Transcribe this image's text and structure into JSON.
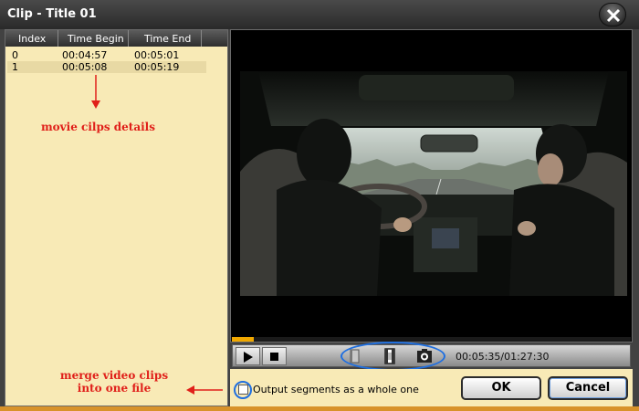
{
  "window": {
    "title": "Clip - Title 01"
  },
  "clips_table": {
    "headers": [
      "Index",
      "Time Begin",
      "Time End"
    ],
    "rows": [
      {
        "index": "0",
        "begin": "00:04:57",
        "end": "00:05:01",
        "selected": false
      },
      {
        "index": "1",
        "begin": "00:05:08",
        "end": "00:05:19",
        "selected": true
      }
    ]
  },
  "annotations": {
    "clips_details": "movie cilps details",
    "merge_line1": "merge video clips",
    "merge_line2": "into one file"
  },
  "player": {
    "time": "00:05:35/01:27:30",
    "progress": 0.055,
    "buttons": [
      "play-icon",
      "stop-icon",
      "clip-start-icon",
      "clip-end-icon",
      "snapshot-icon"
    ]
  },
  "footer": {
    "output_label": "Output segments as a whole one",
    "output_checked": false,
    "ok_label": "OK",
    "cancel_label": "Cancel"
  },
  "colors": {
    "panel_bg": "#f8eab6",
    "annotation_red": "#e0201a",
    "highlight_blue": "#1f6fe0",
    "progress_orange": "#f0a800"
  }
}
